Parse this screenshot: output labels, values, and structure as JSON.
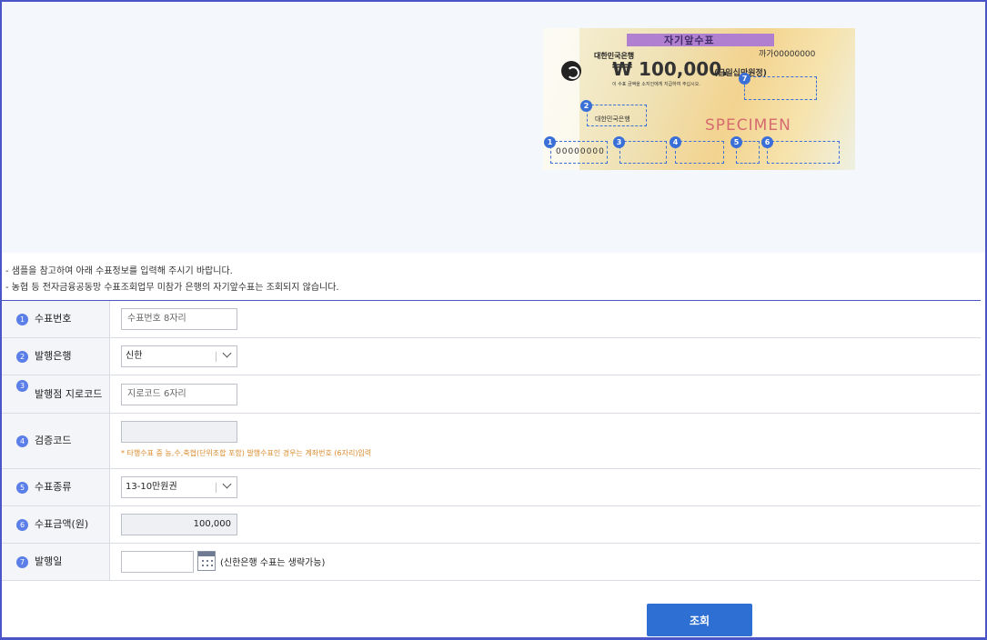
{
  "cheque": {
    "title": "자기앞수표",
    "serial": "까가00000000",
    "bank": "대한민국은행",
    "amount": "₩ 100,000.",
    "amount_korean": "(금일십만원정)",
    "note": "이 수표 금액을 소지인에게 지급하여 주십시오.",
    "branch": "대한민국은행",
    "specimen": "SPECIMEN",
    "number_sample": "00000000",
    "markers": [
      "1",
      "2",
      "3",
      "4",
      "5",
      "6",
      "7"
    ]
  },
  "notices": [
    "-  샘플을 참고하여 아래 수표정보를 입력해 주시기 바랍니다.",
    "-  농협 등 전자금융공동망 수표조회업무 미참가 은행의 자기앞수표는 조회되지 않습니다."
  ],
  "form": {
    "rows": [
      {
        "num": "1",
        "label": "수표번호"
      },
      {
        "num": "2",
        "label": "발행은행"
      },
      {
        "num": "3",
        "label": "발행점 지로코드"
      },
      {
        "num": "4",
        "label": "검증코드"
      },
      {
        "num": "5",
        "label": "수표종류"
      },
      {
        "num": "6",
        "label": "수표금액(원)"
      },
      {
        "num": "7",
        "label": "발행일"
      }
    ],
    "check_number_placeholder": "수표번호 8자리",
    "issuing_bank_value": "신한",
    "giro_code_placeholder": "지로코드 6자리",
    "verify_code_warning": "* 타행수표 중 농,수,축협(단위조합 포함) 발행수표인 경우는 계좌번호 (6자리)입력",
    "check_type_value": "13-10만원권",
    "amount_value": "100,000",
    "issue_date_hint": "(신한은행 수표는 생략가능)"
  },
  "submit_label": "조회",
  "colors": {
    "accent": "#2d6fd2",
    "frame": "#4a55c8",
    "warning": "#d98a2b",
    "badge": "#5b7ee8"
  }
}
